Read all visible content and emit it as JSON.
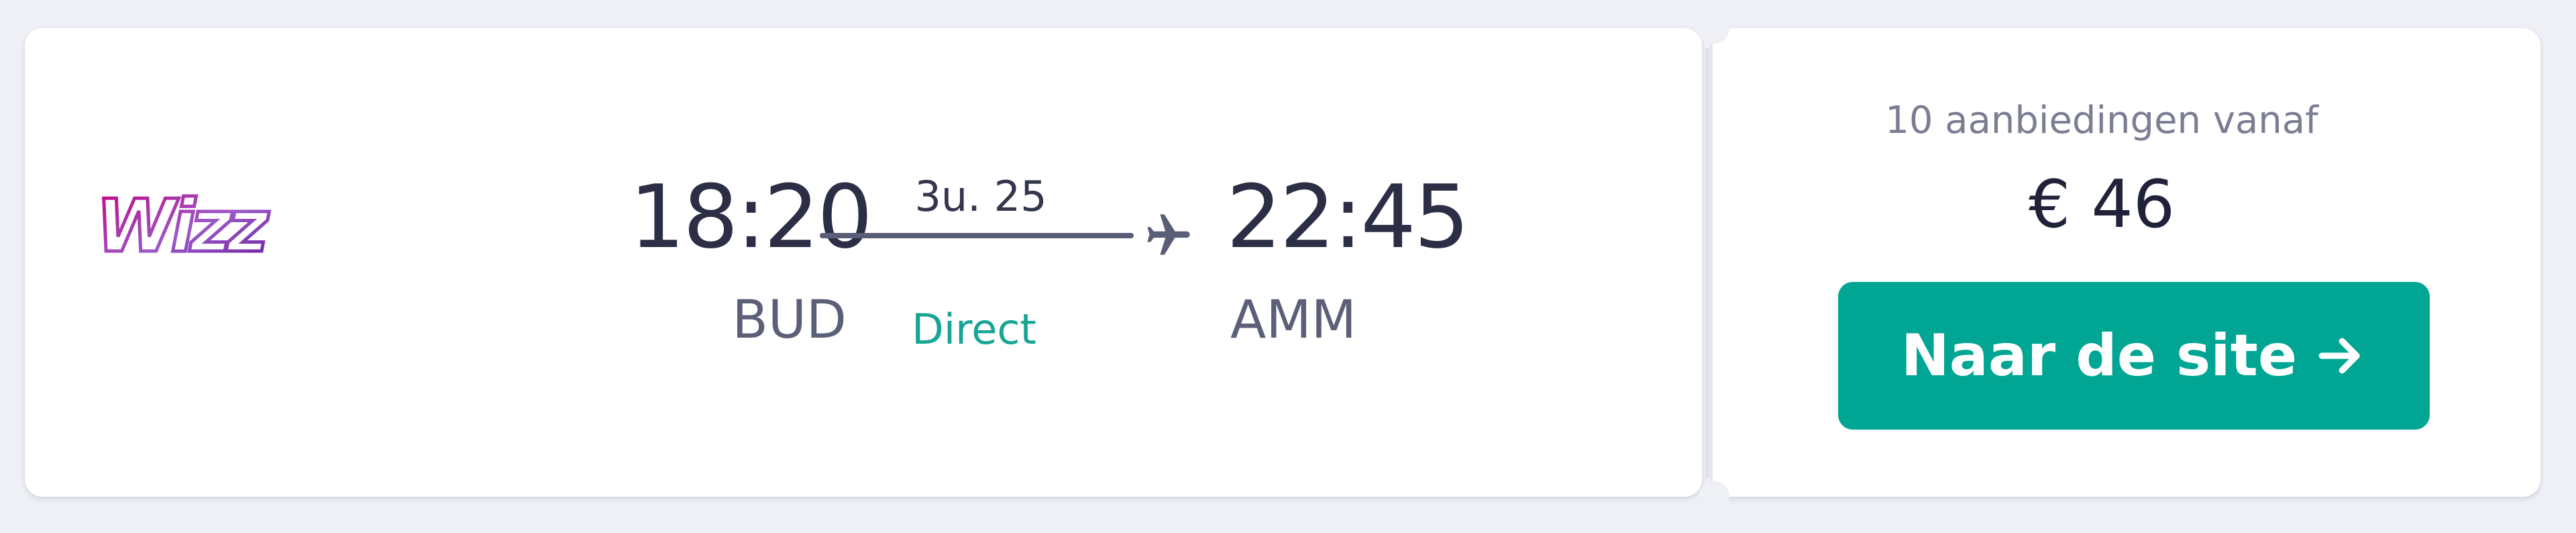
{
  "flight": {
    "airline": {
      "name": "Wizz",
      "colors": [
        "#c6007e",
        "#6a1b9a",
        "#9b59c8"
      ]
    },
    "departure": {
      "time": "18:20",
      "airport": "BUD"
    },
    "arrival": {
      "time": "22:45",
      "airport": "AMM"
    },
    "duration": "3u. 25",
    "stops": "Direct",
    "plane_icon": "plane-icon"
  },
  "deal": {
    "offers_text": "10 aanbiedingen vanaf",
    "price": "€ 46",
    "cta_label": "Naar de site",
    "cta_icon": "arrow-right-icon"
  },
  "colors": {
    "accent": "#00a693",
    "direct": "#17a594",
    "background": "#eef0f5",
    "card": "#ffffff"
  }
}
